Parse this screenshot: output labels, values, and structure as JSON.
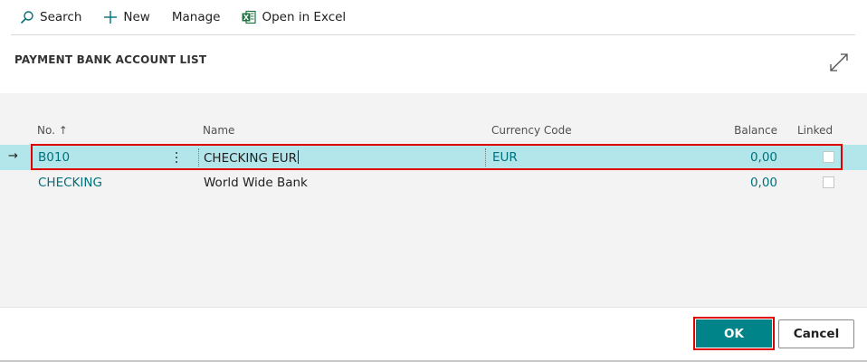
{
  "toolbar": {
    "search_label": "Search",
    "new_label": "New",
    "manage_label": "Manage",
    "excel_label": "Open in Excel"
  },
  "page": {
    "title": "PAYMENT BANK ACCOUNT LIST"
  },
  "table": {
    "headers": {
      "no": "No. ↑",
      "name": "Name",
      "currency_code": "Currency Code",
      "balance": "Balance",
      "linked": "Linked"
    },
    "rows": [
      {
        "no": "B010",
        "name": "CHECKING EUR",
        "currency_code": "EUR",
        "balance": "0,00",
        "linked": false
      },
      {
        "no": "CHECKING",
        "name": "World Wide Bank",
        "currency_code": "",
        "balance": "0,00",
        "linked": false
      }
    ],
    "current_row_indicator": "→"
  },
  "footer": {
    "ok_label": "OK",
    "cancel_label": "Cancel"
  },
  "colors": {
    "accent": "#008489",
    "link": "#00707a",
    "selected_row": "#b2e6ea",
    "highlight": "#e00000",
    "excel_green": "#217346"
  }
}
